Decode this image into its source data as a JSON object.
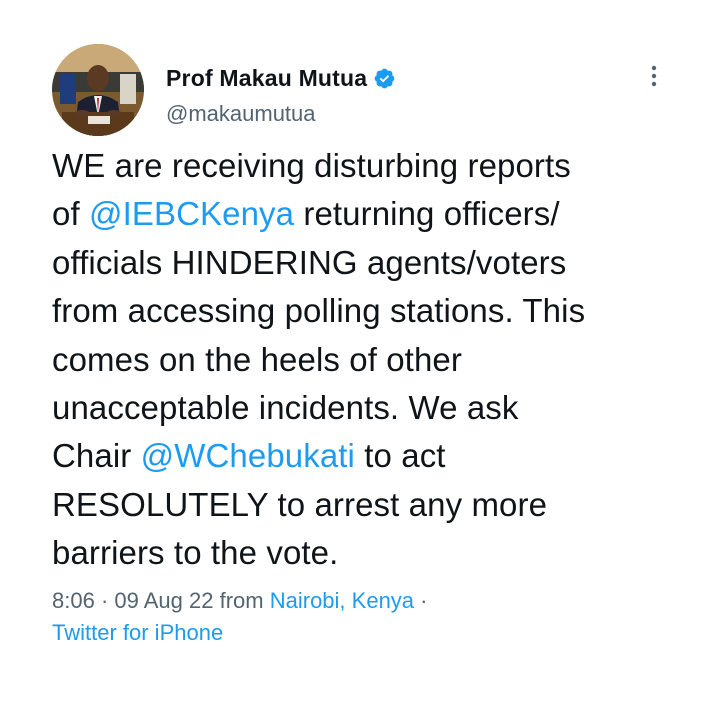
{
  "author": {
    "display_name": "Prof Makau Mutua",
    "handle": "@makaumutua",
    "verified": true,
    "verified_color": "#1d9bf0",
    "avatar_icon": "profile-photo"
  },
  "menu_icon": "more-vertical-icon",
  "tweet": {
    "lines": [
      [
        {
          "t": "WE are receiving disturbing reports"
        }
      ],
      [
        {
          "t": "of "
        },
        {
          "t": "@IEBCKenya",
          "mention": true
        },
        {
          "t": " returning officers/"
        }
      ],
      [
        {
          "t": "officials HINDERING agents/voters"
        }
      ],
      [
        {
          "t": "from accessing polling stations.  This"
        }
      ],
      [
        {
          "t": "comes on the heels of other"
        }
      ],
      [
        {
          "t": "unacceptable incidents.  We ask"
        }
      ],
      [
        {
          "t": "Chair "
        },
        {
          "t": "@WChebukati",
          "mention": true
        },
        {
          "t": " to act"
        }
      ],
      [
        {
          "t": "RESOLUTELY to arrest any more"
        }
      ],
      [
        {
          "t": "barriers to the vote."
        }
      ]
    ],
    "mention_color": "#1d9bf0"
  },
  "meta": {
    "time": "8:06",
    "separator": " · ",
    "date": "09 Aug 22",
    "from_label": " from ",
    "location": "Nairobi, Kenya",
    "trailing_separator": " ·",
    "client": "Twitter for iPhone"
  }
}
